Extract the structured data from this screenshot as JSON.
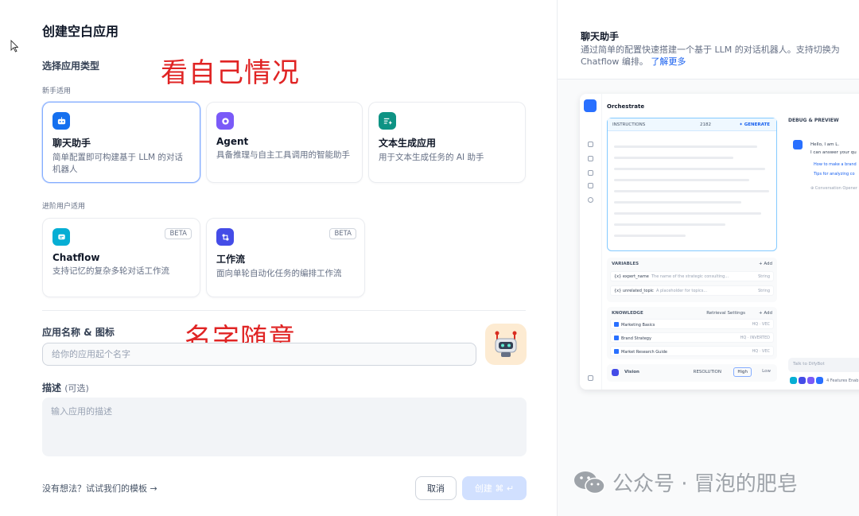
{
  "dialog": {
    "title": "创建空白应用",
    "type_section_label": "选择应用类型",
    "beginner_label": "新手适用",
    "advanced_label": "进阶用户适用",
    "beginner_cards": [
      {
        "name": "聊天助手",
        "desc": "简单配置即可构建基于 LLM 的对话机器人",
        "icon": "chat-bot-icon",
        "selected": true
      },
      {
        "name": "Agent",
        "desc": "具备推理与自主工具调用的智能助手",
        "icon": "agent-icon",
        "selected": false
      },
      {
        "name": "文本生成应用",
        "desc": "用于文本生成任务的 AI 助手",
        "icon": "text-generate-icon",
        "selected": false
      }
    ],
    "advanced_cards": [
      {
        "name": "Chatflow",
        "desc": "支持记忆的复杂多轮对话工作流",
        "badge": "BETA",
        "icon": "chatflow-icon"
      },
      {
        "name": "工作流",
        "desc": "面向单轮自动化任务的编排工作流",
        "badge": "BETA",
        "icon": "workflow-icon"
      }
    ],
    "name_label": "应用名称 & 图标",
    "name_placeholder": "给你的应用起个名字",
    "desc_label": "描述",
    "desc_optional": "(可选)",
    "desc_placeholder": "输入应用的描述",
    "template_link": "没有想法？试试我们的模板 →",
    "cancel_label": "取消",
    "create_label": "创建 ⌘ ↵"
  },
  "annotations": {
    "type_note": "看自己情况",
    "name_note": "名字随意"
  },
  "preview": {
    "title": "聊天助手",
    "desc": "通过简单的配置快速搭建一个基于 LLM 的对话机器人。支持切换为 Chatflow 编排。",
    "learn_more": "了解更多",
    "orchestrate": "Orchestrate",
    "instructions": "INSTRUCTIONS",
    "instr_count": "2182",
    "generate": "✦ GENERATE",
    "debug": "DEBUG & PREVIEW",
    "variables_label": "VARIABLES",
    "add_label": "+ Add",
    "variables": [
      {
        "name": "{x} expert_name",
        "desc": "The name of the strategic consulting...",
        "type": "String"
      },
      {
        "name": "{x} unrelated_topic",
        "desc": "A placeholder for topics...",
        "type": "String"
      }
    ],
    "knowledge_label": "KNOWLEDGE",
    "retrieval": "Retrieval Settings",
    "knowledge": [
      {
        "name": "Marketing Basics",
        "tag": "HQ · VEC"
      },
      {
        "name": "Brand Strategy",
        "tag": "HQ · INVERTED"
      },
      {
        "name": "Market Research Guide",
        "tag": "HQ · VEC"
      }
    ],
    "vision": "Vision",
    "resolution": "RESOLUTION",
    "high": "High",
    "low": "Low",
    "chat_hello": "Hello, I am L.",
    "chat_can": "I can answer your qu",
    "chat_link1": "How to make a brand",
    "chat_link2": "Tips for analyzing co",
    "conv_opener": "⊕ Conversation Opener",
    "talk_placeholder": "Talk to DifyBot",
    "features": "4 Features Enab"
  },
  "watermark": "公众号 · 冒泡的肥皂",
  "colors": {
    "accent": "#155eef",
    "selected_border": "#84adff",
    "annotation_red": "#e02424",
    "chat_icon_bg": "#1570ef",
    "agent_icon_bg": "#7a5af8",
    "text_icon_bg": "#0e9384",
    "chatflow_icon_bg": "#06aed4",
    "workflow_icon_bg": "#444ce7"
  }
}
